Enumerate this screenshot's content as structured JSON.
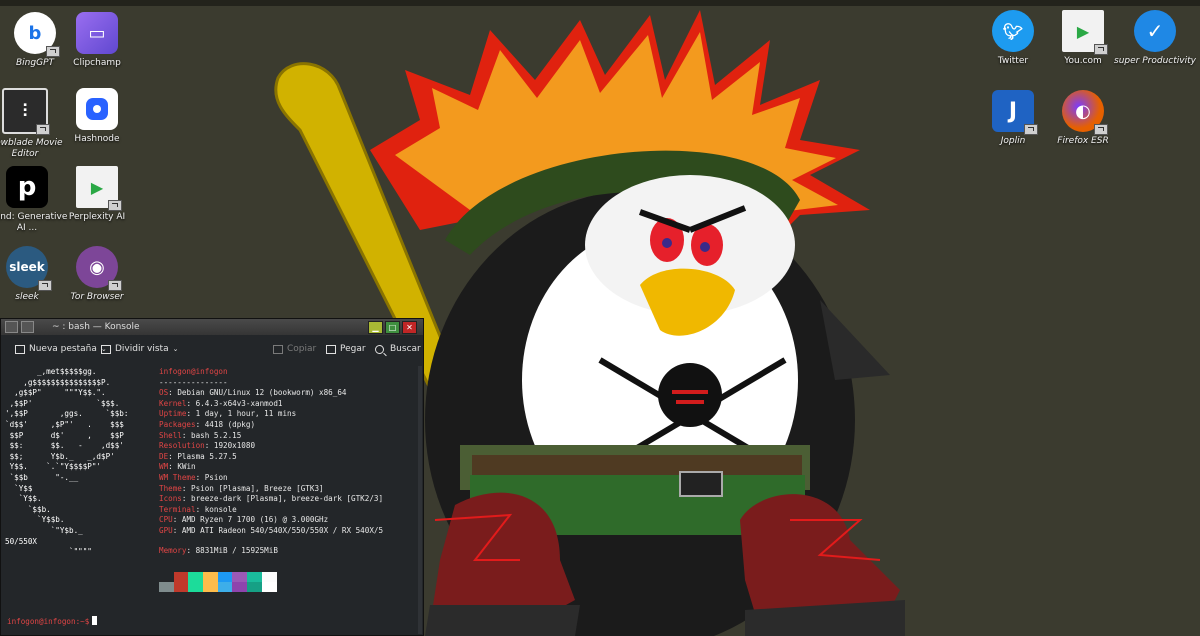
{
  "desktop": {
    "left_icons": [
      {
        "label": "BingGPT",
        "icon": "bing-icon",
        "color": "#1a73e8",
        "italic": true
      },
      {
        "label": "Clipchamp",
        "icon": "clipchamp-icon",
        "color": "#7b5bd6",
        "italic": false
      },
      {
        "label": "Flowblade Movie Editor",
        "icon": "flowblade-icon",
        "color": "#2b2b2b",
        "italic": true
      },
      {
        "label": "Hashnode",
        "icon": "hashnode-icon",
        "color": "#2962ff",
        "italic": false
      },
      {
        "label": "Phind: Generative AI ...",
        "icon": "phind-icon",
        "color": "#000000",
        "italic": false
      },
      {
        "label": "Perplexity AI",
        "icon": "perplexity-icon",
        "color": "#2aa845",
        "italic": false
      },
      {
        "label": "sleek",
        "icon": "sleek-icon",
        "color": "#2b5a80",
        "italic": true
      },
      {
        "label": "Tor Browser",
        "icon": "tor-icon",
        "color": "#7d4698",
        "italic": true
      }
    ],
    "right_icons": [
      {
        "label": "Twitter",
        "icon": "twitter-icon",
        "color": "#1d9bf0",
        "italic": false
      },
      {
        "label": "You.com",
        "icon": "youcom-icon",
        "color": "#2aa845",
        "italic": false
      },
      {
        "label": "super Productivity",
        "icon": "super-productivity-icon",
        "color": "#1f88e5",
        "italic": true
      },
      {
        "label": "Joplin",
        "icon": "joplin-icon",
        "color": "#1f63c3",
        "italic": true
      },
      {
        "label": "Firefox ESR",
        "icon": "firefox-icon",
        "color": "#e66000",
        "italic": true
      }
    ]
  },
  "konsole": {
    "title": "~ : bash — Konsole",
    "toolbar": {
      "new_tab": "Nueva pestaña",
      "split_view": "Dividir vista",
      "copy": "Copiar",
      "paste": "Pegar",
      "search": "Buscar"
    },
    "logo_lines": [
      "       _,met$$$$$gg.",
      "    ,g$$$$$$$$$$$$$$$P.",
      "  ,g$$P\"     \"\"\"Y$$.\".",
      " ,$$P'              `$$$.",
      "',$$P       ,ggs.     `$$b:",
      "`d$$'     ,$P\"'   .    $$$",
      " $$P      d$'     ,    $$P",
      " $$:      $$.   -    ,d$$'",
      " $$;      Y$b._   _,d$P'",
      " Y$$.    `.`\"Y$$$$P\"'",
      " `$$b      \"-.__",
      "  `Y$$",
      "   `Y$$.",
      "     `$$b.",
      "       `Y$$b.",
      "          `\"Y$b._",
      "50/550X",
      "              `\"\"\"\""
    ],
    "user_host": "infogon@infogon",
    "separator": "---------------",
    "info": [
      {
        "key": "OS",
        "value": "Debian GNU/Linux 12 (bookworm) x86_64"
      },
      {
        "key": "Kernel",
        "value": "6.4.3-x64v3-xanmod1"
      },
      {
        "key": "Uptime",
        "value": "1 day, 1 hour, 11 mins"
      },
      {
        "key": "Packages",
        "value": "4418 (dpkg)"
      },
      {
        "key": "Shell",
        "value": "bash 5.2.15"
      },
      {
        "key": "Resolution",
        "value": "1920x1080"
      },
      {
        "key": "DE",
        "value": "Plasma 5.27.5"
      },
      {
        "key": "WM",
        "value": "KWin"
      },
      {
        "key": "WM Theme",
        "value": "Psion"
      },
      {
        "key": "Theme",
        "value": "Psion [Plasma], Breeze [GTK3]"
      },
      {
        "key": "Icons",
        "value": "breeze-dark [Plasma], breeze-dark [GTK2/3]"
      },
      {
        "key": "Terminal",
        "value": "konsole"
      },
      {
        "key": "CPU",
        "value": "AMD Ryzen 7 1700 (16) @ 3.000GHz"
      },
      {
        "key": "GPU",
        "value": "AMD ATI Radeon 540/540X/550/550X / RX 540X/5"
      }
    ],
    "memory": {
      "key": "Memory",
      "value": "8831MiB / 15925MiB"
    },
    "palette_colors": [
      "#232629",
      "#c0392b",
      "#1cdc9a",
      "#fdbc4b",
      "#1d99f3",
      "#9b59b6",
      "#1abc9c",
      "#fcfcfc",
      "#7f8c8d",
      "#c0392b",
      "#1cdc9a",
      "#fdbc4b",
      "#3daee9",
      "#8e44ad",
      "#16a085",
      "#ffffff"
    ],
    "prompt": "infogon@infogon:~$"
  }
}
